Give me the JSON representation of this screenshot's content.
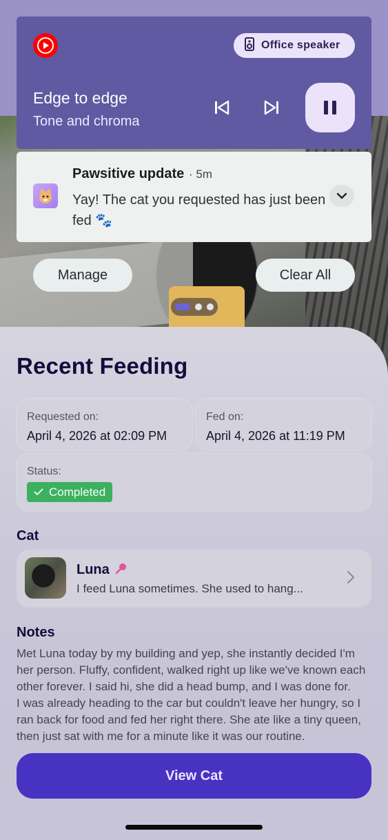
{
  "media": {
    "app_icon": "youtube-music-icon",
    "speaker_chip": "Office speaker",
    "track_title": "Edge to edge",
    "track_subtitle": "Tone and chroma",
    "colors": {
      "card": "#5f5aa2",
      "chip": "#ece3fb"
    }
  },
  "notification": {
    "app_name": "Pawsitive update",
    "time": "5m",
    "body": "Yay! The cat you requested has just been fed 🐾",
    "actions": {
      "manage": "Manage",
      "clear_all": "Clear All"
    }
  },
  "sheet": {
    "title": "Recent Feeding",
    "requested": {
      "label": "Requested on:",
      "value": "April 4, 2026 at 02:09 PM"
    },
    "fed": {
      "label": "Fed on:",
      "value": "April 4, 2026 at 11:19 PM"
    },
    "status": {
      "label": "Status:",
      "value": "Completed",
      "color": "#3cb060"
    },
    "cat_section": "Cat",
    "cat": {
      "name": "Luna",
      "description": "I feed Luna sometimes. She used to hang..."
    },
    "notes_section": "Notes",
    "notes_p1": "Met Luna today by my building and yep, she instantly decided I'm her person. Fluffy, confident, walked right up like we've known each other forever. I said hi, she did a head bump, and I was done for.",
    "notes_p2": "I was already heading to the car but couldn't leave her hungry, so I ran back for food and fed her right there. She ate like a tiny queen, then just sat with me for a minute like it was our routine.",
    "cta": "View Cat",
    "accent": "#4832c2"
  }
}
